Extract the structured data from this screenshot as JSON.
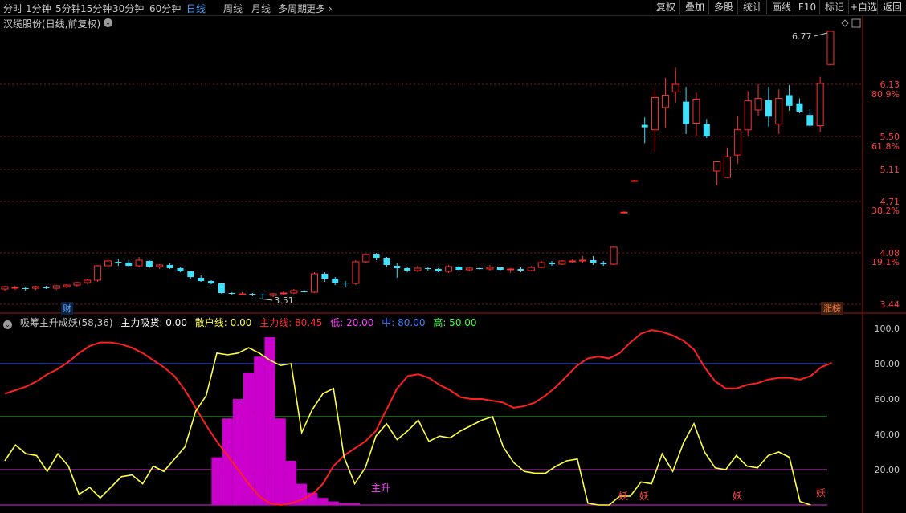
{
  "toolbar": {
    "timeframes": [
      "分时",
      "1分钟",
      "5分钟",
      "15分钟",
      "30分钟",
      "60分钟",
      "日线",
      "周线",
      "月线",
      "多周期",
      "更多"
    ],
    "active_timeframe": "日线",
    "right_buttons": [
      "复权",
      "叠加",
      "多股",
      "统计",
      "画线",
      "F10",
      "标记",
      "+自选",
      "返回"
    ]
  },
  "stock": {
    "title": "汉缆股份(日线,前复权)"
  },
  "price_axis": {
    "ticks": [
      "6.13",
      "5.50",
      "5.11",
      "4.71",
      "4.08",
      "3.44"
    ],
    "pct_ticks": [
      "80.9%",
      "61.8%",
      "38.2%",
      "19.1%"
    ],
    "high_label": "6.77",
    "low_label": "3.51"
  },
  "badges": {
    "cai": "财",
    "zhangbang": "涨榜"
  },
  "indicator": {
    "name": "吸筹主升成妖(58,36)",
    "items": [
      {
        "label": "主力吸货: 0.00",
        "color": "#ffffff"
      },
      {
        "label": "散户线: 0.00",
        "color": "#ffff40"
      },
      {
        "label": "主力线: 80.45",
        "color": "#ff3030"
      },
      {
        "label": "低: 20.00",
        "color": "#ff40ff"
      },
      {
        "label": "中: 80.00",
        "color": "#4080ff"
      },
      {
        "label": "高: 50.00",
        "color": "#40ff40"
      }
    ],
    "axis_ticks": [
      "100.0",
      "80.00",
      "60.00",
      "40.00",
      "20.00"
    ],
    "signals": [
      "主升",
      "妖",
      "妖",
      "妖",
      "妖"
    ]
  },
  "colors": {
    "up": "#ff3030",
    "down": "#40e0ff",
    "main_line": "#ff2020",
    "retail_line": "#ffff40",
    "absorb": "#cc00cc",
    "grid": "#801818"
  },
  "chart_data": [
    {
      "type": "candlestick",
      "title": "汉缆股份(日线,前复权)",
      "ylim": [
        3.44,
        6.77
      ],
      "candles": [
        {
          "o": 3.63,
          "h": 3.67,
          "l": 3.6,
          "c": 3.66
        },
        {
          "o": 3.64,
          "h": 3.67,
          "l": 3.62,
          "c": 3.65
        },
        {
          "o": 3.64,
          "h": 3.66,
          "l": 3.61,
          "c": 3.63
        },
        {
          "o": 3.64,
          "h": 3.67,
          "l": 3.62,
          "c": 3.66
        },
        {
          "o": 3.65,
          "h": 3.67,
          "l": 3.63,
          "c": 3.64
        },
        {
          "o": 3.64,
          "h": 3.68,
          "l": 3.62,
          "c": 3.67
        },
        {
          "o": 3.66,
          "h": 3.69,
          "l": 3.64,
          "c": 3.68
        },
        {
          "o": 3.68,
          "h": 3.72,
          "l": 3.66,
          "c": 3.71
        },
        {
          "o": 3.71,
          "h": 3.76,
          "l": 3.69,
          "c": 3.74
        },
        {
          "o": 3.74,
          "h": 3.93,
          "l": 3.72,
          "c": 3.92
        },
        {
          "o": 3.92,
          "h": 4.02,
          "l": 3.9,
          "c": 3.98
        },
        {
          "o": 3.97,
          "h": 4.01,
          "l": 3.92,
          "c": 3.96
        },
        {
          "o": 3.96,
          "h": 3.99,
          "l": 3.9,
          "c": 3.92
        },
        {
          "o": 3.92,
          "h": 4.03,
          "l": 3.9,
          "c": 3.99
        },
        {
          "o": 3.98,
          "h": 3.99,
          "l": 3.89,
          "c": 3.91
        },
        {
          "o": 3.91,
          "h": 3.94,
          "l": 3.88,
          "c": 3.93
        },
        {
          "o": 3.93,
          "h": 3.95,
          "l": 3.88,
          "c": 3.89
        },
        {
          "o": 3.89,
          "h": 3.9,
          "l": 3.84,
          "c": 3.85
        },
        {
          "o": 3.85,
          "h": 3.86,
          "l": 3.76,
          "c": 3.78
        },
        {
          "o": 3.77,
          "h": 3.8,
          "l": 3.72,
          "c": 3.73
        },
        {
          "o": 3.73,
          "h": 3.74,
          "l": 3.69,
          "c": 3.7
        },
        {
          "o": 3.7,
          "h": 3.71,
          "l": 3.57,
          "c": 3.58
        },
        {
          "o": 3.58,
          "h": 3.59,
          "l": 3.56,
          "c": 3.57
        },
        {
          "o": 3.57,
          "h": 3.59,
          "l": 3.55,
          "c": 3.57
        },
        {
          "o": 3.57,
          "h": 3.58,
          "l": 3.54,
          "c": 3.56
        },
        {
          "o": 3.56,
          "h": 3.57,
          "l": 3.51,
          "c": 3.55
        },
        {
          "o": 3.55,
          "h": 3.58,
          "l": 3.53,
          "c": 3.57
        },
        {
          "o": 3.57,
          "h": 3.6,
          "l": 3.55,
          "c": 3.58
        },
        {
          "o": 3.58,
          "h": 3.63,
          "l": 3.57,
          "c": 3.61
        },
        {
          "o": 3.6,
          "h": 3.62,
          "l": 3.58,
          "c": 3.59
        },
        {
          "o": 3.59,
          "h": 3.84,
          "l": 3.58,
          "c": 3.82
        },
        {
          "o": 3.82,
          "h": 3.84,
          "l": 3.72,
          "c": 3.76
        },
        {
          "o": 3.76,
          "h": 3.78,
          "l": 3.68,
          "c": 3.71
        },
        {
          "o": 3.71,
          "h": 3.73,
          "l": 3.65,
          "c": 3.7
        },
        {
          "o": 3.7,
          "h": 3.99,
          "l": 3.68,
          "c": 3.97
        },
        {
          "o": 3.97,
          "h": 4.07,
          "l": 3.95,
          "c": 4.06
        },
        {
          "o": 4.06,
          "h": 4.08,
          "l": 3.99,
          "c": 4.02
        },
        {
          "o": 4.02,
          "h": 4.03,
          "l": 3.91,
          "c": 3.93
        },
        {
          "o": 3.92,
          "h": 3.95,
          "l": 3.77,
          "c": 3.89
        },
        {
          "o": 3.89,
          "h": 3.9,
          "l": 3.84,
          "c": 3.86
        },
        {
          "o": 3.86,
          "h": 3.92,
          "l": 3.84,
          "c": 3.89
        },
        {
          "o": 3.89,
          "h": 3.91,
          "l": 3.86,
          "c": 3.88
        },
        {
          "o": 3.88,
          "h": 3.89,
          "l": 3.84,
          "c": 3.85
        },
        {
          "o": 3.85,
          "h": 3.93,
          "l": 3.83,
          "c": 3.91
        },
        {
          "o": 3.91,
          "h": 3.92,
          "l": 3.86,
          "c": 3.87
        },
        {
          "o": 3.87,
          "h": 3.9,
          "l": 3.85,
          "c": 3.89
        },
        {
          "o": 3.89,
          "h": 3.91,
          "l": 3.87,
          "c": 3.88
        },
        {
          "o": 3.88,
          "h": 3.93,
          "l": 3.86,
          "c": 3.9
        },
        {
          "o": 3.9,
          "h": 3.91,
          "l": 3.85,
          "c": 3.87
        },
        {
          "o": 3.87,
          "h": 3.89,
          "l": 3.83,
          "c": 3.88
        },
        {
          "o": 3.88,
          "h": 3.9,
          "l": 3.84,
          "c": 3.86
        },
        {
          "o": 3.86,
          "h": 3.92,
          "l": 3.85,
          "c": 3.9
        },
        {
          "o": 3.9,
          "h": 3.98,
          "l": 3.89,
          "c": 3.96
        },
        {
          "o": 3.96,
          "h": 3.98,
          "l": 3.92,
          "c": 3.94
        },
        {
          "o": 3.94,
          "h": 3.99,
          "l": 3.93,
          "c": 3.98
        },
        {
          "o": 3.98,
          "h": 4.0,
          "l": 3.96,
          "c": 3.98
        },
        {
          "o": 3.98,
          "h": 4.04,
          "l": 3.96,
          "c": 3.99
        },
        {
          "o": 3.99,
          "h": 4.04,
          "l": 3.93,
          "c": 3.96
        },
        {
          "o": 3.96,
          "h": 3.98,
          "l": 3.92,
          "c": 3.94
        },
        {
          "o": 3.94,
          "h": 4.16,
          "l": 3.93,
          "c": 4.15
        },
        {
          "o": 4.58,
          "h": 4.59,
          "l": 4.57,
          "c": 4.58
        },
        {
          "o": 4.97,
          "h": 4.98,
          "l": 4.96,
          "c": 4.97
        },
        {
          "o": 5.64,
          "h": 5.73,
          "l": 5.42,
          "c": 5.61
        },
        {
          "o": 5.58,
          "h": 6.08,
          "l": 5.32,
          "c": 5.97
        },
        {
          "o": 5.85,
          "h": 6.21,
          "l": 5.6,
          "c": 6.0
        },
        {
          "o": 6.04,
          "h": 6.33,
          "l": 5.91,
          "c": 6.13
        },
        {
          "o": 5.92,
          "h": 6.1,
          "l": 5.53,
          "c": 5.65
        },
        {
          "o": 5.66,
          "h": 6.03,
          "l": 5.51,
          "c": 5.95
        },
        {
          "o": 5.65,
          "h": 5.71,
          "l": 5.48,
          "c": 5.5
        },
        {
          "o": 5.09,
          "h": 5.18,
          "l": 4.91,
          "c": 5.2
        },
        {
          "o": 5.01,
          "h": 5.37,
          "l": 5.0,
          "c": 5.26
        },
        {
          "o": 5.28,
          "h": 5.75,
          "l": 5.18,
          "c": 5.58
        },
        {
          "o": 5.58,
          "h": 6.05,
          "l": 5.51,
          "c": 5.93
        },
        {
          "o": 5.82,
          "h": 6.13,
          "l": 5.75,
          "c": 5.96
        },
        {
          "o": 5.94,
          "h": 6.1,
          "l": 5.62,
          "c": 5.74
        },
        {
          "o": 5.65,
          "h": 6.07,
          "l": 5.53,
          "c": 5.96
        },
        {
          "o": 6.0,
          "h": 6.12,
          "l": 5.81,
          "c": 5.87
        },
        {
          "o": 5.9,
          "h": 5.96,
          "l": 5.78,
          "c": 5.8
        },
        {
          "o": 5.76,
          "h": 5.83,
          "l": 5.62,
          "c": 5.63
        },
        {
          "o": 5.63,
          "h": 6.22,
          "l": 5.55,
          "c": 6.14
        },
        {
          "o": 6.37,
          "h": 6.77,
          "l": 6.36,
          "c": 6.77
        }
      ]
    },
    {
      "type": "line",
      "title": "吸筹主升成妖(58,36)",
      "ylim": [
        0,
        100
      ],
      "hlines": {
        "低": 20,
        "中": 80,
        "高": 50
      },
      "x": [
        0,
        1,
        2,
        3,
        4,
        5,
        6,
        7,
        8,
        9,
        10,
        11,
        12,
        13,
        14,
        15,
        16,
        17,
        18,
        19,
        20,
        21,
        22,
        23,
        24,
        25,
        26,
        27,
        28,
        29,
        30,
        31,
        32,
        33,
        34,
        35,
        36,
        37,
        38,
        39,
        40,
        41,
        42,
        43,
        44,
        45,
        46,
        47,
        48,
        49,
        50,
        51,
        52,
        53,
        54,
        55,
        56,
        57,
        58,
        59,
        60,
        61,
        62,
        63,
        64,
        65,
        66,
        67,
        68,
        69,
        70,
        71,
        72,
        73,
        74,
        75,
        76,
        77,
        78
      ],
      "series": [
        {
          "name": "主力线",
          "values": [
            63,
            65,
            67,
            70,
            74,
            77,
            81,
            86,
            90,
            92,
            92,
            91,
            89,
            86,
            82,
            78,
            73,
            65,
            55,
            45,
            36,
            28,
            20,
            12,
            5,
            1,
            0,
            1,
            3,
            6,
            12,
            22,
            28,
            32,
            36,
            42,
            54,
            66,
            73,
            74,
            72,
            68,
            65,
            61,
            60,
            60,
            59,
            58,
            55,
            56,
            58,
            62,
            67,
            73,
            79,
            83,
            84,
            83,
            86,
            92,
            97,
            99,
            98,
            96,
            93,
            88,
            78,
            70,
            66,
            66,
            68,
            69,
            71,
            72,
            72,
            71,
            73,
            78,
            80.45
          ]
        },
        {
          "name": "散户线",
          "values": [
            25,
            34,
            29,
            28,
            19,
            29,
            22,
            6,
            10,
            4,
            10,
            16,
            17,
            12,
            22,
            19,
            26,
            33,
            53,
            62,
            86,
            85,
            86,
            89,
            86,
            82,
            79,
            80,
            41,
            54,
            63,
            66,
            27,
            12,
            21,
            39,
            46,
            37,
            42,
            48,
            36,
            39,
            38,
            42,
            45,
            48,
            50,
            33,
            24,
            19,
            18,
            18,
            22,
            25,
            26,
            1,
            0,
            0,
            5,
            5,
            13,
            12,
            29,
            19,
            35,
            46,
            30,
            21,
            20,
            28,
            22,
            21,
            28,
            30,
            27,
            2,
            0
          ]
        },
        {
          "name": "主力吸货",
          "values": [
            0,
            0,
            0,
            0,
            0,
            0,
            0,
            0,
            0,
            0,
            0,
            0,
            0,
            0,
            0,
            0,
            0,
            0,
            0,
            0,
            27,
            49,
            60,
            75,
            84,
            95,
            49,
            25,
            12,
            7,
            4,
            2,
            1,
            1,
            0,
            0,
            0,
            0,
            0,
            0,
            0,
            0,
            0,
            0,
            0,
            0,
            0,
            0,
            0,
            0,
            0,
            0,
            0,
            0,
            0,
            0,
            0,
            0,
            0,
            0,
            0,
            0,
            0,
            0,
            0,
            0,
            0,
            0,
            0,
            0,
            0,
            0,
            0,
            0,
            0,
            0,
            0
          ]
        }
      ]
    }
  ]
}
